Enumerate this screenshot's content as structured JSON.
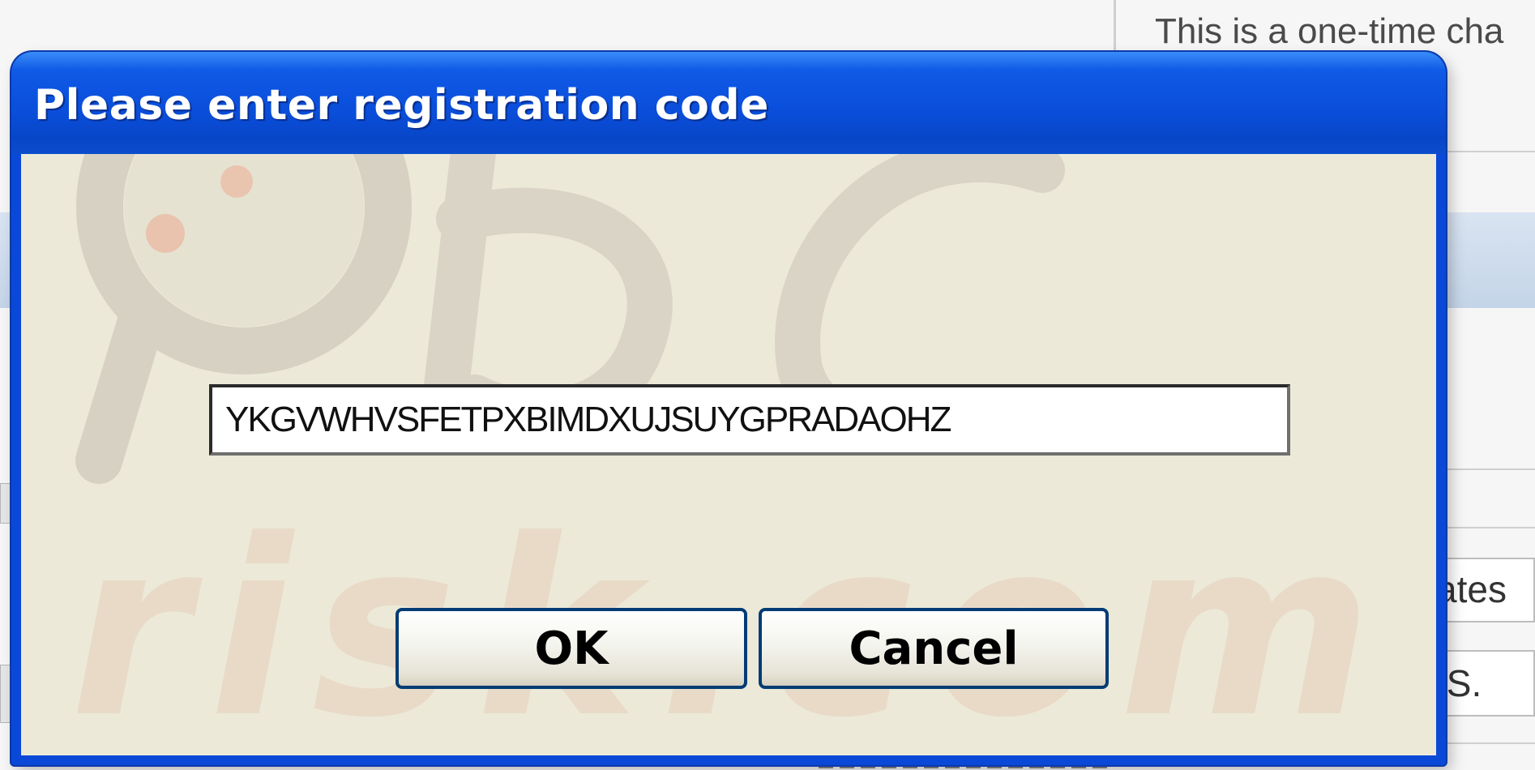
{
  "background": {
    "top_right_text": "This is a one-time cha",
    "field_fragment_1": "ates",
    "field_fragment_2": ".S."
  },
  "dialog": {
    "title": "Please enter registration code",
    "registration_code": "YKGVWHVSFETPXBIMDXUJSUYGPRADAOHZ",
    "ok_label": "OK",
    "cancel_label": "Cancel",
    "watermark_text": "risk.com"
  },
  "colors": {
    "title_bar": "#0a4fdc",
    "dialog_body": "#ece9d8",
    "button_border": "#003c74",
    "watermark": "#c9c2b2"
  }
}
